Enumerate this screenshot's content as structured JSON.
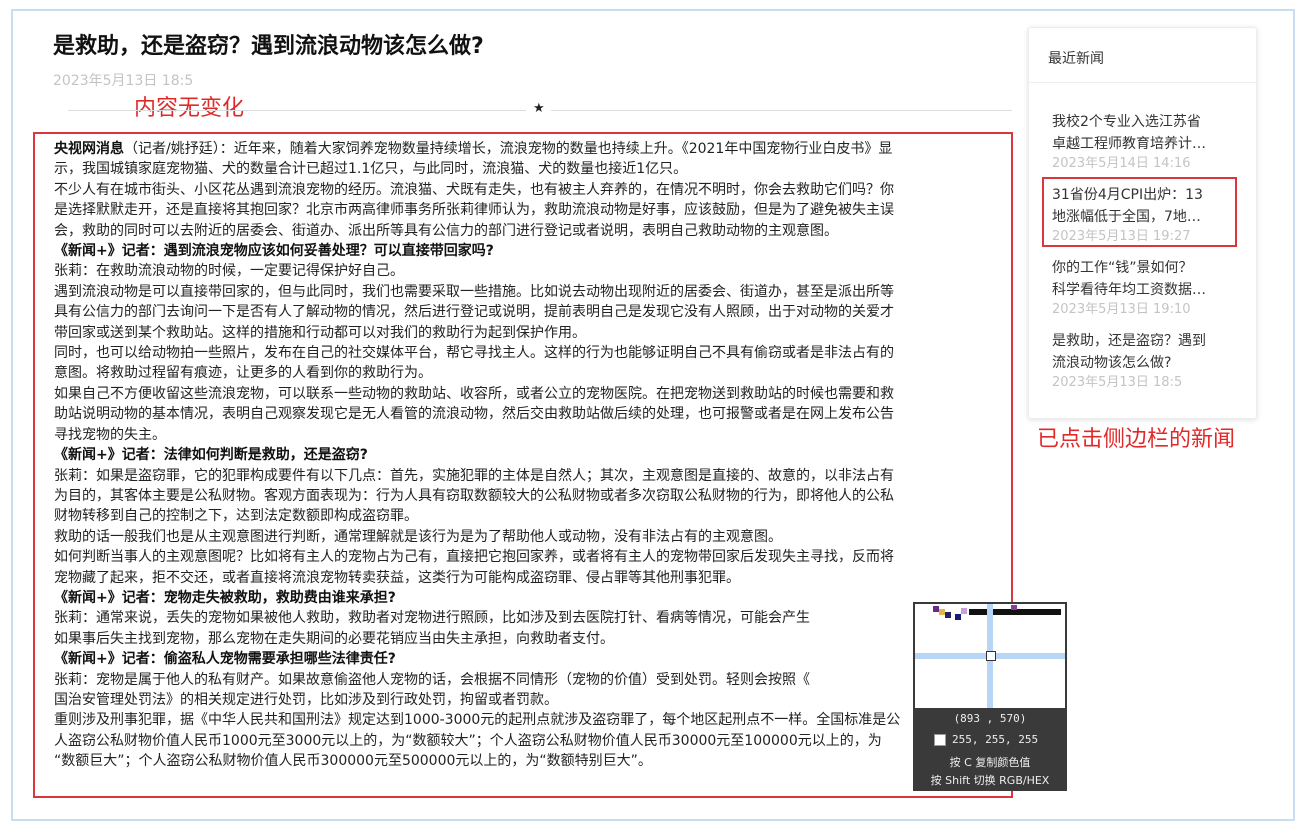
{
  "article": {
    "title": "是救助，还是盗窃？遇到流浪动物该怎么做?",
    "date": "2023年5月13日 18:5",
    "divider_glyph": "★",
    "paragraphs": [
      {
        "bold": "央视网消息",
        "text": "（记者/姚抒廷）：近年来，随着大家饲养宠物数量持续增长，流浪宠物的数量也持续上升。《2021年中国宠物行业白皮书》显"
      },
      {
        "bold": "",
        "text": "示，我国城镇家庭宠物猫、犬的数量合计已超过1.1亿只，与此同时，流浪猫、犬的数量也接近1亿只。"
      },
      {
        "bold": "",
        "text": "不少人有在城市街头、小区花丛遇到流浪宠物的经历。流浪猫、犬既有走失，也有被主人弃养的，在情况不明时，你会去救助它们吗？你"
      },
      {
        "bold": "",
        "text": "是选择默默走开，还是直接将其抱回家？北京市两高律师事务所张莉律师认为，救助流浪动物是好事，应该鼓励，但是为了避免被失主误"
      },
      {
        "bold": "",
        "text": "会，救助的同时可以去附近的居委会、街道办、派出所等具有公信力的部门进行登记或者说明，表明自己救助动物的主观意图。"
      },
      {
        "bold": "《新闻+》记者：遇到流浪宠物应该如何妥善处理？可以直接带回家吗?",
        "text": ""
      },
      {
        "bold": "",
        "text": "张莉：在救助流浪动物的时候，一定要记得保护好自己。"
      },
      {
        "bold": "",
        "text": "遇到流浪动物是可以直接带回家的，但与此同时，我们也需要采取一些措施。比如说去动物出现附近的居委会、街道办，甚至是派出所等"
      },
      {
        "bold": "",
        "text": "具有公信力的部门去询问一下是否有人了解动物的情况，然后进行登记或说明，提前表明自己是发现它没有人照顾，出于对动物的关爱才"
      },
      {
        "bold": "",
        "text": "带回家或送到某个救助站。这样的措施和行动都可以对我们的救助行为起到保护作用。"
      },
      {
        "bold": "",
        "text": "同时，也可以给动物拍一些照片，发布在自己的社交媒体平台，帮它寻找主人。这样的行为也能够证明自己不具有偷窃或者是非法占有的"
      },
      {
        "bold": "",
        "text": "意图。将救助过程留有痕迹，让更多的人看到你的救助行为。"
      },
      {
        "bold": "",
        "text": "如果自己不方便收留这些流浪宠物，可以联系一些动物的救助站、收容所，或者公立的宠物医院。在把宠物送到救助站的时候也需要和救"
      },
      {
        "bold": "",
        "text": "助站说明动物的基本情况，表明自己观察发现它是无人看管的流浪动物，然后交由救助站做后续的处理，也可报警或者是在网上发布公告"
      },
      {
        "bold": "",
        "text": "寻找宠物的失主。"
      },
      {
        "bold": "《新闻+》记者：法律如何判断是救助，还是盗窃?",
        "text": ""
      },
      {
        "bold": "",
        "text": "张莉：如果是盗窃罪，它的犯罪构成要件有以下几点：首先，实施犯罪的主体是自然人；其次，主观意图是直接的、故意的，以非法占有"
      },
      {
        "bold": "",
        "text": "为目的，其客体主要是公私财物。客观方面表现为：行为人具有窃取数额较大的公私财物或者多次窃取公私财物的行为，即将他人的公私"
      },
      {
        "bold": "",
        "text": "财物转移到自己的控制之下，达到法定数额即构成盗窃罪。"
      },
      {
        "bold": "",
        "text": "救助的话一般我们也是从主观意图进行判断，通常理解就是该行为是为了帮助他人或动物，没有非法占有的主观意图。"
      },
      {
        "bold": "",
        "text": "如何判断当事人的主观意图呢？比如将有主人的宠物占为己有，直接把它抱回家养，或者将有主人的宠物带回家后发现失主寻找，反而将"
      },
      {
        "bold": "",
        "text": "宠物藏了起来，拒不交还，或者直接将流浪宠物转卖获益，这类行为可能构成盗窃罪、侵占罪等其他刑事犯罪。"
      },
      {
        "bold": "《新闻+》记者：宠物走失被救助，救助费由谁来承担?",
        "text": ""
      },
      {
        "bold": "",
        "text": "张莉：通常来说，丢失的宠物如果被他人救助，救助者对宠物进行照顾，比如涉及到去医院打针、看病等情况，可能会产生"
      },
      {
        "bold": "",
        "text": "如果事后失主找到宠物，那么宠物在走失期间的必要花销应当由失主承担，向救助者支付。"
      },
      {
        "bold": "《新闻+》记者：偷盗私人宠物需要承担哪些法律责任?",
        "text": ""
      },
      {
        "bold": "",
        "text": "张莉：宠物是属于他人的私有财产。如果故意偷盗他人宠物的话，会根据不同情形（宠物的价值）受到处罚。轻则会按照《"
      },
      {
        "bold": "",
        "text": "国治安管理处罚法》的相关规定进行处罚，比如涉及到行政处罚，拘留或者罚款。"
      },
      {
        "bold": "",
        "text": "重则涉及刑事犯罪，据《中华人民共和国刑法》规定达到1000-3000元的起刑点就涉及盗窃罪了，每个地区起刑点不一样。全国标准是公"
      },
      {
        "bold": "",
        "text": "人盗窃公私财物价值人民币1000元至3000元以上的，为“数额较大”；个人盗窃公私财物价值人民币30000元至100000元以上的，为"
      },
      {
        "bold": "",
        "text": "“数额巨大”；个人盗窃公私财物价值人民币300000元至500000元以上的，为“数额特别巨大”。"
      }
    ]
  },
  "annotations": {
    "content_unchanged": "内容无变化",
    "sidebar_clicked": "已点击侧边栏的新闻"
  },
  "sidebar": {
    "title": "最近新闻",
    "items": [
      {
        "title_line1": "我校2个专业入选江苏省",
        "title_line2": "卓越工程师教育培养计…",
        "date": "2023年5月14日 14:16"
      },
      {
        "title_line1": "31省份4月CPI出炉：13",
        "title_line2": "地涨幅低于全国，7地…",
        "date": "2023年5月13日 19:27"
      },
      {
        "title_line1": "你的工作“钱”景如何？",
        "title_line2": "科学看待年均工资数据…",
        "date": "2023年5月13日 19:10"
      },
      {
        "title_line1": "是救助，还是盗窃？遇到",
        "title_line2": "流浪动物该怎么做?",
        "date": "2023年5月13日 18:5"
      }
    ]
  },
  "color_picker": {
    "coords": "(893 , 570)",
    "rgb": "255, 255, 255",
    "hint_copy": "按 C 复制颜色值",
    "hint_switch": "按 Shift 切换 RGB/HEX"
  },
  "colors": {
    "accent_red": "#d9363e",
    "annotation_red": "#e02a2a",
    "muted_date": "#c4c4c4",
    "frame_border": "#c9dcf0"
  }
}
